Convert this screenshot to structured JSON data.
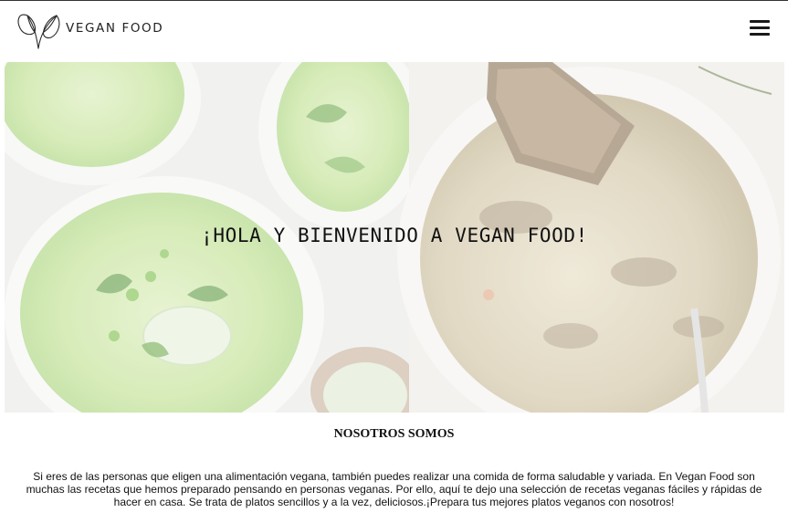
{
  "header": {
    "brand": "VEGAN FOOD",
    "logo_icon": "leaf-logo-icon",
    "menu_icon": "hamburger-menu-icon"
  },
  "hero": {
    "title": "¡HOLA Y BIENVENIDO A VEGAN FOOD!",
    "images": [
      "green-pea-soup-bowls",
      "mushroom-stew-bowl-with-bread"
    ]
  },
  "about": {
    "heading": "NOSOTROS SOMOS",
    "body": "Si eres de las personas que eligen una alimentación vegana, también puedes realizar una comida de forma saludable y variada. En Vegan Food son muchas las recetas que hemos preparado pensando en personas veganas. Por ello, aquí te dejo una selección de recetas veganas fáciles y rápidas de hacer en casa. Se trata de platos sencillos y a la vez, deliciosos.¡Prepara tus mejores platos veganos con nosotros!"
  }
}
